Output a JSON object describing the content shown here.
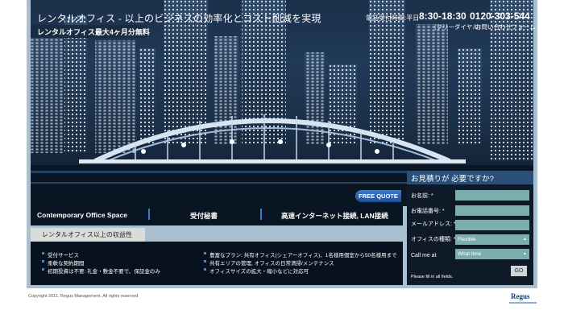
{
  "header": {
    "title": "レンタルオフィス - 以上のビジネスの効率化とコスト削減を実現",
    "subtitle": "レンタルオフィス最大4ヶ月分無料",
    "phone_label": "電話受付時間:平日",
    "phone_hours": "8:30-18:30",
    "phone_number": "0120-303-544",
    "phone_note": "(フリーダイヤル)",
    "contact_link": "お問い合わせフォーム"
  },
  "hero": {
    "free_quote_label": "FREE QUOTE"
  },
  "nav": {
    "items": [
      {
        "label": "Contemporary Office Space"
      },
      {
        "label": "受付秘書"
      },
      {
        "label": "高速インターネット接続, LAN接続"
      }
    ]
  },
  "benefits": {
    "title": "レンタルオフィス以上の収益性",
    "left": [
      "受付サービス",
      "柔軟な契約期間",
      "初期投資は不要: 礼金・敷金不要で、保証金のみ"
    ],
    "right": [
      "豊富なプラン: 共有オフィス(シェアーオフィス)、1名様用個室から50名様用まで",
      "共有エリアの管理, オフィスの日常清掃/メンテナンス",
      "オフィスサイズの拡大・縮小などに対応可"
    ]
  },
  "quote_form": {
    "title": "お見積りが 必要ですか?",
    "name_label": "お名前: *",
    "phone_label": "お電話番号: *",
    "email_label": "メールアドレス: *",
    "office_type_label": "オフィスの種類: *",
    "office_type_value": "Flexible",
    "call_me_label": "Call me at",
    "call_time_value": "What time",
    "note": "Please fill in all fields.",
    "go_label": "GO"
  },
  "footer": {
    "copyright": "Copyright 2011. Regus Management. All rights reserved",
    "logo": "Regus"
  },
  "colors": {
    "accent": "#3f7bc4",
    "field": "#7aaeae",
    "frame": "#a9c0d2",
    "dark": "#08121e"
  }
}
